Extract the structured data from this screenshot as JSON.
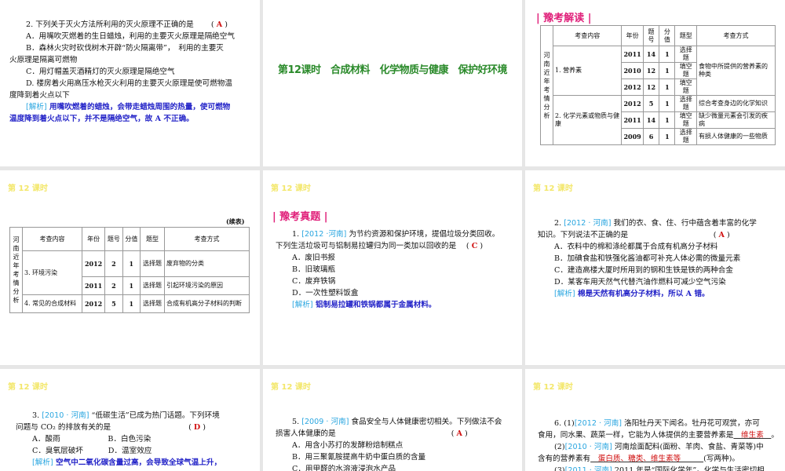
{
  "lesson_label": "第 12 课时",
  "slides": [
    {
      "lines": [
        [
          {
            "t": "2. 下列关于灭火方法所利用的灭火原理不正确的是　　 ( "
          },
          {
            "t": "A",
            "c": "ans"
          },
          {
            "t": " )"
          }
        ],
        [
          {
            "t": "A．用嘴吹灭燃着的生日蜡烛，利用的主要灭火原理是隔绝空气"
          }
        ],
        [
          {
            "t": "B．森林火灾时砍伐树木开辟“防火隔离带”，　利用的主要灭"
          }
        ],
        {
          "noind": true,
          "segs": [
            {
              "t": "火原理是隔离可燃物"
            }
          ]
        },
        [
          {
            "t": "C．用灯帽盖灭酒精灯的灭火原理是隔绝空气"
          }
        ],
        [
          {
            "t": "D. 楼房着火用高压水枪灭火利用的主要灭火原理是使可燃物温"
          }
        ],
        {
          "noind": true,
          "segs": [
            {
              "t": "度降到着火点以下"
            }
          ]
        },
        [
          {
            "t": "[解析]",
            "c": "tag"
          },
          {
            "t": " 用嘴吹燃着的蜡烛，会带走蜡烛周围的热量，使可燃物",
            "c": "ana"
          }
        ],
        {
          "noind": true,
          "segs": [
            {
              "t": "温度降到着火点以下，并不是隔绝空气，故 A 不正确。",
              "c": "ana"
            }
          ]
        }
      ]
    },
    {
      "title": "第12课时　合成材料　化学物质与健康　保护好环境"
    },
    {
      "section": "| 豫考解读 |",
      "table": {
        "side": "河南近年考情分析",
        "headers": [
          "考查内容",
          "年份",
          "题号",
          "分值",
          "题型",
          "考查方式"
        ],
        "rows": [
          [
            {
              "t": "1. 营养素",
              "rs": 3
            },
            {
              "t": "2011"
            },
            {
              "t": "14"
            },
            {
              "t": "1"
            },
            {
              "t": "选择题"
            },
            {
              "t": "食物中所提供的营养素的种类",
              "rs": 3
            }
          ],
          [
            {
              "t": "2010"
            },
            {
              "t": "12"
            },
            {
              "t": "1"
            },
            {
              "t": "填空题"
            }
          ],
          [
            {
              "t": "2012"
            },
            {
              "t": "12"
            },
            {
              "t": "1"
            },
            {
              "t": "填空题"
            }
          ],
          [
            {
              "t": "2. 化学元素或物质与健康",
              "rs": 3
            },
            {
              "t": "2012"
            },
            {
              "t": "5"
            },
            {
              "t": "1"
            },
            {
              "t": "选择题"
            },
            {
              "t": "综合考查身边的化学知识"
            }
          ],
          [
            {
              "t": "2011"
            },
            {
              "t": "14"
            },
            {
              "t": "1"
            },
            {
              "t": "填空题"
            },
            {
              "t": "缺少微量元素会引发的疾病"
            }
          ],
          [
            {
              "t": "2009"
            },
            {
              "t": "6"
            },
            {
              "t": "1"
            },
            {
              "t": "选择题"
            },
            {
              "t": "有损人体健康的一些物质"
            }
          ]
        ]
      }
    },
    {
      "continued": "(续表)",
      "table": {
        "side": "河南近年考情分析",
        "headers": [
          "考查内容",
          "年份",
          "题号",
          "分值",
          "题型",
          "考查方式"
        ],
        "rows": [
          [
            {
              "t": "3. 环境污染",
              "rs": 2
            },
            {
              "t": "2012"
            },
            {
              "t": "2"
            },
            {
              "t": "1"
            },
            {
              "t": "选择题"
            },
            {
              "t": "废弃物的分类"
            }
          ],
          [
            {
              "t": "2011"
            },
            {
              "t": "2"
            },
            {
              "t": "1"
            },
            {
              "t": "选择题"
            },
            {
              "t": "引起环境污染的原因"
            }
          ],
          [
            {
              "t": "4. 常见的合成材料"
            },
            {
              "t": "2012"
            },
            {
              "t": "5"
            },
            {
              "t": "1"
            },
            {
              "t": "选择题"
            },
            {
              "t": "合成有机高分子材料的判断"
            }
          ]
        ]
      }
    },
    {
      "section": "| 豫考真题 |",
      "lines": [
        [
          {
            "t": "1. "
          },
          {
            "t": "[2012 ·河南]",
            "c": "src"
          },
          {
            "t": " 为节约资源和保护环境，提倡垃圾分类回收。"
          }
        ],
        {
          "noind": true,
          "segs": [
            {
              "t": "下列生活垃圾可与铝制易拉罐归为同一类加以回收的是　 ( "
            },
            {
              "t": "C",
              "c": "ans"
            },
            {
              "t": " )"
            }
          ]
        },
        [
          {
            "t": "A．废旧书报"
          }
        ],
        [
          {
            "t": "B．旧玻璃瓶"
          }
        ],
        [
          {
            "t": "C．废弃铁锅"
          }
        ],
        [
          {
            "t": "D．一次性塑料饭盒"
          }
        ],
        [
          {
            "t": "[解析]",
            "c": "tag"
          },
          {
            "t": " 铝制易拉罐和铁锅都属于金属材料。",
            "c": "ana"
          }
        ]
      ]
    },
    {
      "lines": [
        [
          {
            "t": "2. "
          },
          {
            "t": "[2012 · 河南]",
            "c": "src"
          },
          {
            "t": " 我们的衣、食、住、行中蕴含着丰富的化学"
          }
        ],
        {
          "noind": true,
          "segs": [
            {
              "t": "知识。下列说法不正确的是　　　　　　　　　　　 ( "
            },
            {
              "t": "A",
              "c": "ans"
            },
            {
              "t": " )"
            }
          ]
        },
        [
          {
            "t": "A．衣料中的棉和涤纶都属于合成有机高分子材料"
          }
        ],
        [
          {
            "t": "B．加碘食盐和铁强化酱油都可补充人体必需的微量元素"
          }
        ],
        [
          {
            "t": "C．建造高楼大厦时所用到的钢和生铁是铁的两种合金"
          }
        ],
        [
          {
            "t": "D．某客车用天然气代替汽油作燃料可减少空气污染"
          }
        ],
        [
          {
            "t": "[解析]",
            "c": "tag"
          },
          {
            "t": " 棉是天然有机高分子材料，所以 A 错。",
            "c": "ana"
          }
        ]
      ]
    },
    {
      "lines": [
        [
          {
            "t": "3. "
          },
          {
            "t": "[2010 · 河南]",
            "c": "src"
          },
          {
            "t": " “低碳生活”已成为热门话题。下列环境"
          }
        ],
        {
          "noind": true,
          "segs": [
            {
              "t": "问题与 CO₂ 的排放有关的是　　　　　　　　　　 ( "
            },
            {
              "t": "D",
              "c": "ans"
            },
            {
              "t": " )"
            }
          ]
        },
        [
          {
            "t": "A．酸雨　　　　　　 B．白色污染"
          }
        ],
        [
          {
            "t": "C．臭氧层破坏　　　 D．温室效应"
          }
        ],
        [
          {
            "t": "[解析]",
            "c": "tag"
          },
          {
            "t": " 空气中二氧化碳含量过高，会导致全球气温上升，",
            "c": "ana"
          }
        ]
      ]
    },
    {
      "lines": [
        [
          {
            "t": "5. "
          },
          {
            "t": "[2009 · 河南]",
            "c": "src"
          },
          {
            "t": " 食品安全与人体健康密切相关。下列做法不会"
          }
        ],
        {
          "noind": true,
          "segs": [
            {
              "t": "损害人体健康的是　　　　　　　　　　　　　　　 ( "
            },
            {
              "t": "A",
              "c": "ans"
            },
            {
              "t": " )"
            }
          ]
        },
        [
          {
            "t": "A．用含小苏打的发酵粉焙制糕点"
          }
        ],
        [
          {
            "t": "B．用三聚氰胺提高牛奶中蛋白质的含量"
          }
        ],
        [
          {
            "t": "C．用甲醛的水溶液浸泡水产品"
          }
        ]
      ]
    },
    {
      "lines": [
        [
          {
            "t": "6. (1)"
          },
          {
            "t": "[2012 · 河南]",
            "c": "src"
          },
          {
            "t": " 洛阳牡丹天下闻名。牡丹花可观赏，亦可"
          }
        ],
        {
          "noind": true,
          "segs": [
            {
              "t": "食用，同水果、蔬菜一样，它能为人体提供的主要营养素是"
            },
            {
              "t": "　维生素　",
              "c": "fill"
            },
            {
              "t": "。"
            }
          ]
        },
        [
          {
            "t": "(2)"
          },
          {
            "t": "[2010 · 河南]",
            "c": "src"
          },
          {
            "t": " 河南烩面配料(面粉、羊肉、食盐、青菜等)中"
          }
        ],
        {
          "noind": true,
          "segs": [
            {
              "t": "含有的营养素有"
            },
            {
              "t": "　蛋白质、糖类、维生素等　　　",
              "c": "fill"
            },
            {
              "t": "(写两种)。"
            }
          ]
        },
        [
          {
            "t": "(3)"
          },
          {
            "t": "[2011 · 河南]",
            "c": "src"
          },
          {
            "t": " 2011 年是“国际化学年”。化学与生活密切相"
          }
        ]
      ]
    }
  ]
}
